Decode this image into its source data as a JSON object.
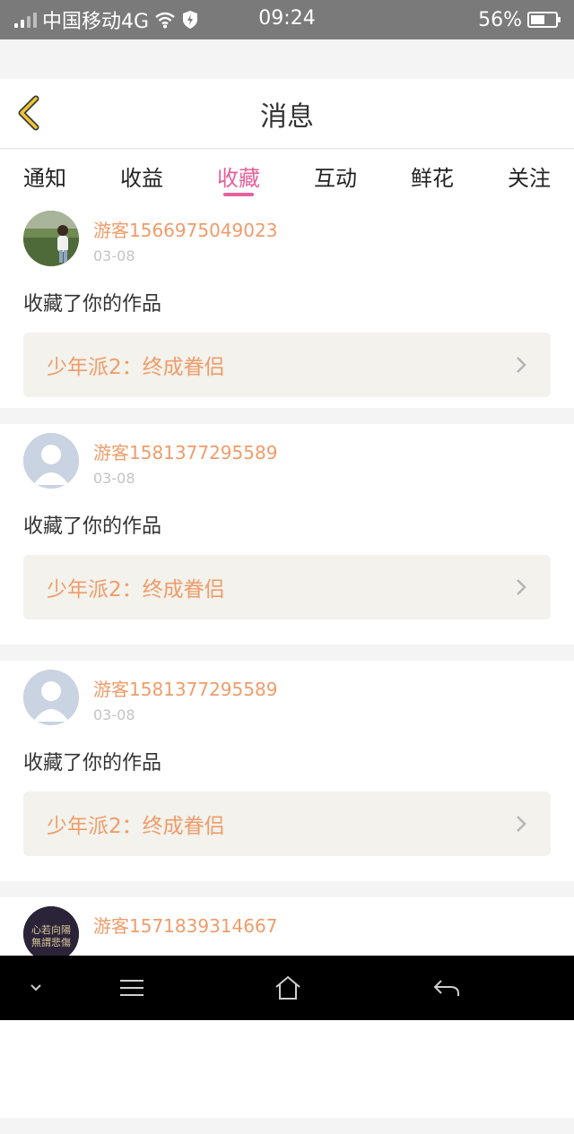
{
  "status_bar": {
    "carrier": "中国移动4G",
    "time": "09:24",
    "battery": "56%",
    "battery_level": 0.56
  },
  "header": {
    "title": "消息"
  },
  "tabs": [
    {
      "label": "通知",
      "active": false
    },
    {
      "label": "收益",
      "active": false
    },
    {
      "label": "收藏",
      "active": true
    },
    {
      "label": "互动",
      "active": false
    },
    {
      "label": "鲜花",
      "active": false
    },
    {
      "label": "关注",
      "active": false
    }
  ],
  "items": [
    {
      "username": "游客1566975049023",
      "date": "03-08",
      "message": "收藏了你的作品",
      "work_title": "少年派2：终成眷侣",
      "avatar": "photo-avatar"
    },
    {
      "username": "游客1581377295589",
      "date": "03-08",
      "message": "收藏了你的作品",
      "work_title": "少年派2：终成眷侣",
      "avatar": "default-avatar"
    },
    {
      "username": "游客1581377295589",
      "date": "03-08",
      "message": "收藏了你的作品",
      "work_title": "少年派2：终成眷侣",
      "avatar": "default-avatar"
    },
    {
      "username": "游客1571839314667",
      "avatar": "calligraphy-avatar",
      "avatar_text": "心若向陽 無謂悲傷"
    }
  ],
  "colors": {
    "accent": "#e5609c",
    "username": "#ef9c6a",
    "back_icon": "#f2c531"
  }
}
